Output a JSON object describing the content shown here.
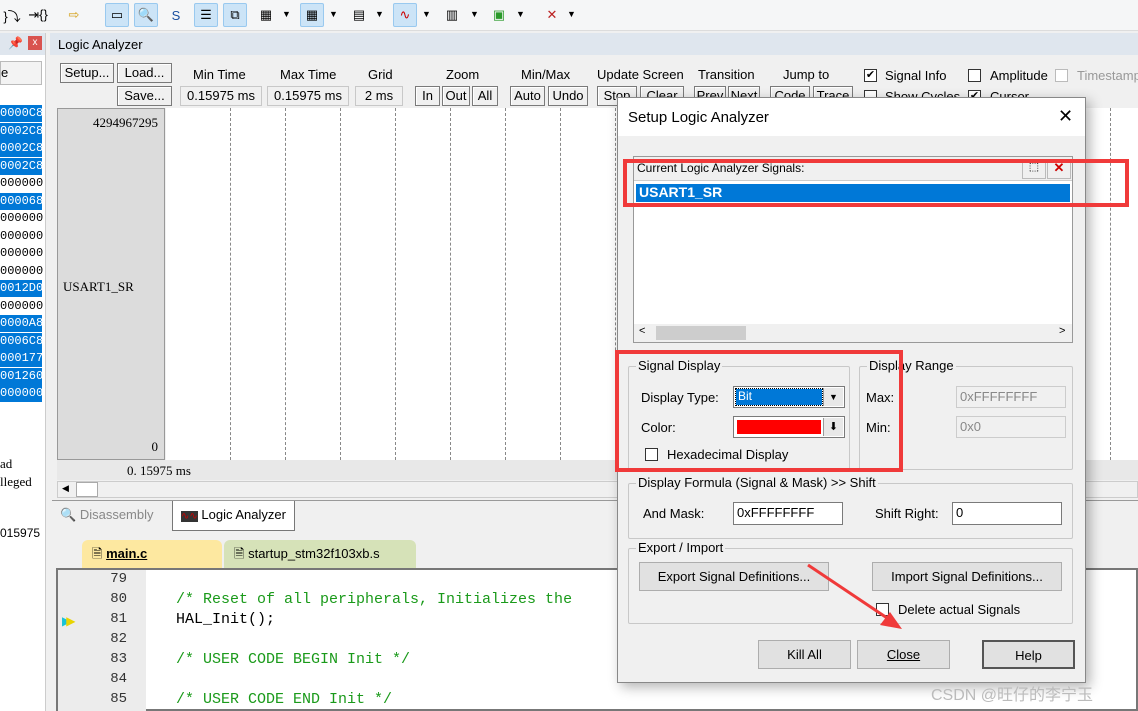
{
  "toolbar": {
    "icons": [
      "step-over-icon",
      "step-out-icon",
      "run-to-cursor-icon",
      "command-window-icon",
      "disassembly-window-icon",
      "symbols-window-icon",
      "registers-window-icon",
      "call-stack-icon",
      "watch-window-icon",
      "memory-window-icon",
      "serial-window-icon",
      "analysis-window-icon",
      "trace-window-icon",
      "system-viewer-icon",
      "toolbox-icon"
    ]
  },
  "left_panel": {
    "header_col": "e",
    "registers": [
      {
        "v": "0000C8",
        "hl": true
      },
      {
        "v": "0002C8",
        "hl": true
      },
      {
        "v": "0002C8",
        "hl": true
      },
      {
        "v": "0002C8",
        "hl": true
      },
      {
        "v": "000000",
        "hl": false
      },
      {
        "v": "000068",
        "hl": true
      },
      {
        "v": "000000",
        "hl": false
      },
      {
        "v": "000000",
        "hl": false
      },
      {
        "v": "000000",
        "hl": false
      },
      {
        "v": "000000",
        "hl": false
      },
      {
        "v": "0012D0",
        "hl": true
      },
      {
        "v": "000000",
        "hl": false
      },
      {
        "v": "0000A8",
        "hl": true
      },
      {
        "v": "0006C8",
        "hl": true
      },
      {
        "v": "000177",
        "hl": true
      },
      {
        "v": "001260",
        "hl": true
      },
      {
        "v": "000000",
        "hl": true
      }
    ],
    "text1": "ad",
    "text2": "lleged",
    "text3": "015975"
  },
  "la": {
    "title": "Logic Analyzer",
    "setup": "Setup...",
    "load": "Load...",
    "save": "Save...",
    "min_time_label": "Min Time",
    "min_time": "0.15975 ms",
    "max_time_label": "Max Time",
    "max_time": "0.15975 ms",
    "grid_label": "Grid",
    "grid": "2 ms",
    "zoom_label": "Zoom",
    "zoom_in": "In",
    "zoom_out": "Out",
    "zoom_all": "All",
    "minmax_label": "Min/Max",
    "auto": "Auto",
    "undo": "Undo",
    "update_label": "Update Screen",
    "stop": "Stop",
    "clear": "Clear",
    "transition_label": "Transition",
    "prev": "Prev",
    "next": "Next",
    "jump_label": "Jump to",
    "code": "Code",
    "trace": "Trace",
    "signal_info": "Signal Info",
    "amplitude": "Amplitude",
    "timestamp": "Timestamp",
    "show_cycles": "Show Cycles",
    "cursor": "Cursor",
    "y_max": "4294967295",
    "y_min": "0",
    "signal": "USART1_SR",
    "time_readout": "0. 15975 ms"
  },
  "tabs": {
    "disassembly": "Disassembly",
    "logic_analyzer": "Logic Analyzer"
  },
  "editor": {
    "tabs": [
      "main.c",
      "startup_stm32f103xb.s"
    ],
    "lines": [
      {
        "n": "79",
        "t": ""
      },
      {
        "n": "80",
        "t": "/* Reset of all peripherals, Initializes the"
      },
      {
        "n": "81",
        "t": "HAL_Init();"
      },
      {
        "n": "82",
        "t": ""
      },
      {
        "n": "83",
        "t": "/* USER CODE BEGIN Init */"
      },
      {
        "n": "84",
        "t": ""
      },
      {
        "n": "85",
        "t": "/* USER CODE END Init */"
      }
    ]
  },
  "dialog": {
    "title": "Setup Logic Analyzer",
    "list_label": "Current Logic Analyzer Signals:",
    "signals": [
      "USART1_SR"
    ],
    "signal_display": "Signal Display",
    "display_type_label": "Display Type:",
    "display_type": "Bit",
    "color_label": "Color:",
    "color": "#ff0000",
    "hex_display": "Hexadecimal Display",
    "display_range": "Display Range",
    "max_label": "Max:",
    "max": "0xFFFFFFFF",
    "min_label": "Min:",
    "min": "0x0",
    "formula": "Display Formula (Signal & Mask) >> Shift",
    "and_mask_label": "And Mask:",
    "and_mask": "0xFFFFFFFF",
    "shift_label": "Shift Right:",
    "shift": "0",
    "export_import": "Export / Import",
    "export": "Export Signal Definitions...",
    "import": "Import Signal Definitions...",
    "delete_signals": "Delete actual Signals",
    "kill_all": "Kill All",
    "close": "Close",
    "help": "Help"
  },
  "watermark": "CSDN @旺仔的李宁玉"
}
